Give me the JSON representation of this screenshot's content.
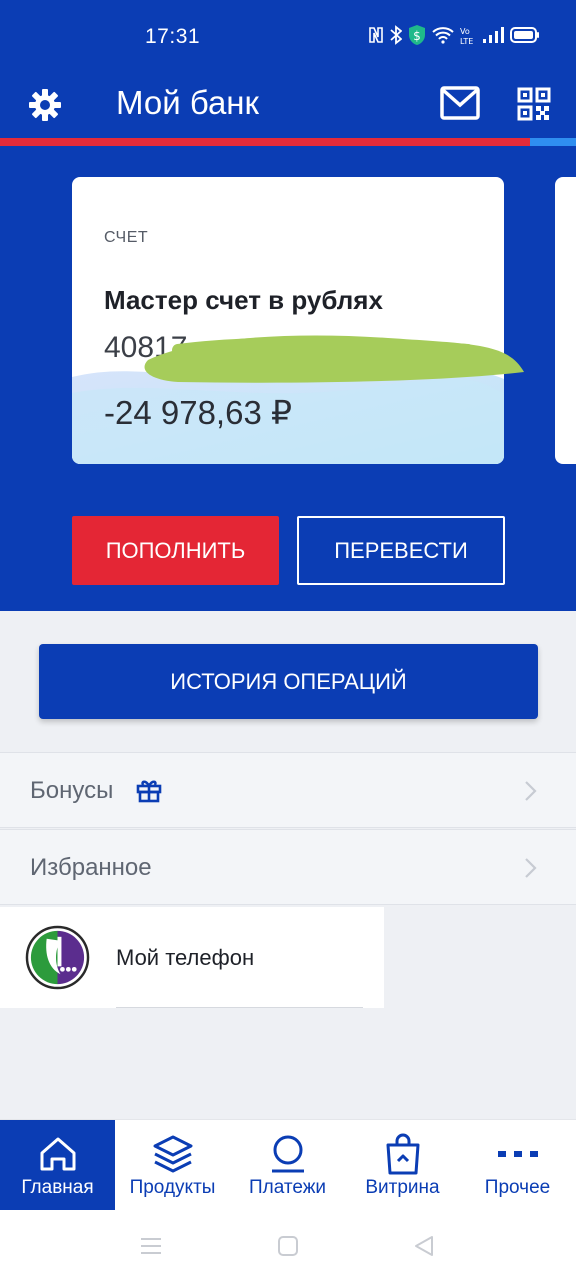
{
  "status_bar": {
    "time": "17:31",
    "icons": [
      "nfc-icon",
      "bluetooth-icon",
      "shield-icon",
      "wifi-icon",
      "volte-icon",
      "signal-icon",
      "battery-icon"
    ]
  },
  "header": {
    "title": "Мой банк",
    "settings_icon": "gear-icon",
    "mail_icon": "mail-icon",
    "qr_icon": "qr-code-icon"
  },
  "colors": {
    "brand_blue": "#0b3db4",
    "accent_red": "#e42635",
    "stripe_light_blue": "#2f8ef0"
  },
  "account_card": {
    "type": "СЧЕТ",
    "name": "Мастер счет в рублях",
    "number_visible": "40817",
    "balance": "-24 978,63 ₽"
  },
  "actions": {
    "topup_label": "ПОПОЛНИТЬ",
    "transfer_label": "ПЕРЕВЕСТИ",
    "history_label": "ИСТОРИЯ ОПЕРАЦИЙ"
  },
  "list": {
    "bonuses": "Бонусы",
    "favorites": "Избранное"
  },
  "favorite_item": {
    "label": "Мой телефон",
    "icon": "megafon-logo"
  },
  "bottom_nav": [
    {
      "label": "Главная",
      "icon": "home-icon",
      "active": true
    },
    {
      "label": "Продукты",
      "icon": "layers-icon",
      "active": false
    },
    {
      "label": "Платежи",
      "icon": "payments-icon",
      "active": false
    },
    {
      "label": "Витрина",
      "icon": "shopping-bag-icon",
      "active": false
    },
    {
      "label": "Прочее",
      "icon": "more-icon",
      "active": false
    }
  ]
}
